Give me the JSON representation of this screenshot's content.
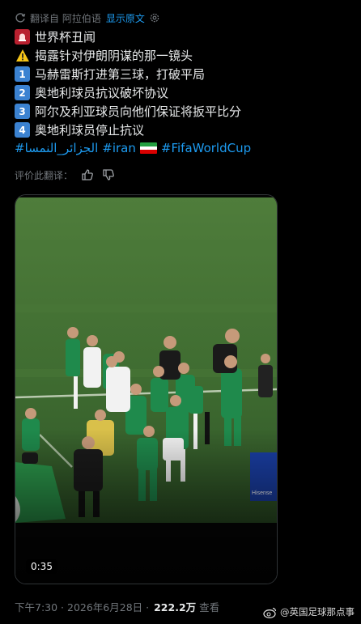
{
  "translation_bar": {
    "translated_from": "翻译自 阿拉伯语",
    "show_original": "显示原文",
    "icon": "translate-icon",
    "settings_icon": "gear-icon"
  },
  "tweet": {
    "lines": [
      {
        "icon": "siren-emoji",
        "text": "世界杯丑闻"
      },
      {
        "icon": "warning-emoji",
        "glyph": "⚠️",
        "text": "揭露针对伊朗阴谋的那一镜头"
      },
      {
        "icon": "keycap-1",
        "glyph": "1",
        "text": "马赫雷斯打进第三球，打破平局"
      },
      {
        "icon": "keycap-2",
        "glyph": "2",
        "text": "奥地利球员抗议破坏协议"
      },
      {
        "icon": "keycap-3",
        "glyph": "3",
        "text": "阿尔及利亚球员向他们保证将扳平比分"
      },
      {
        "icon": "keycap-4",
        "glyph": "4",
        "text": "奥地利球员停止抗议"
      }
    ],
    "hashtags": {
      "first": "#الجزائر_النمسا",
      "second": "#iran",
      "third": "#FifaWorldCup"
    },
    "flag_colors": [
      "#239f40",
      "#ffffff",
      "#da0000"
    ]
  },
  "rate_translation": {
    "label": "评价此翻译：",
    "up_icon": "thumbs-up-icon",
    "down_icon": "thumbs-down-icon"
  },
  "video": {
    "duration": "0:35",
    "pitch_color": "#4c7a3a",
    "jersey_colors": {
      "green": "#1f8a4c",
      "white": "#f2f2f2",
      "dark": "#1a1a1a"
    }
  },
  "meta": {
    "time": "下午7:30 · 2026年6月28日 ·",
    "views": "222.2万",
    "views_label": "查看"
  },
  "watermark": {
    "text": "@英国足球那点事",
    "icon": "weibo-icon"
  },
  "colors": {
    "background": "#000000",
    "link": "#1d9bf0",
    "muted": "#71767b",
    "text": "#e7e9ea"
  }
}
